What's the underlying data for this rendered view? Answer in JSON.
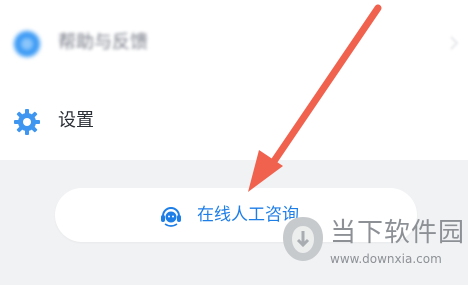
{
  "menu": {
    "items": [
      {
        "label": "帮助与反馈",
        "icon": "help-feedback-icon"
      },
      {
        "label": "设置",
        "icon": "gear-icon"
      }
    ]
  },
  "support": {
    "label": "在线人工咨询",
    "icon": "headset-agent-icon",
    "accent": "#1e7ee8"
  },
  "annotation": {
    "arrow_color": "#f0614e"
  },
  "watermark": {
    "name": "当下软件园",
    "url": "www.downxia.com"
  }
}
